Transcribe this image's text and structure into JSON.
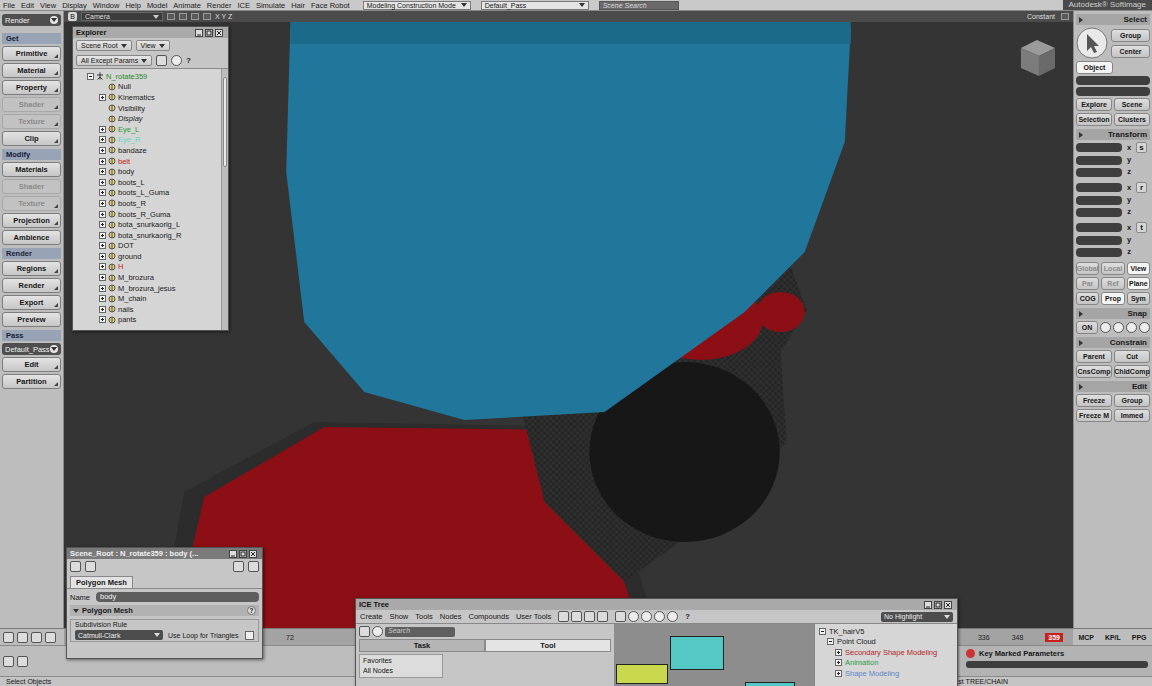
{
  "menu_bar": {
    "items": [
      "File",
      "Edit",
      "View",
      "Display",
      "Window",
      "Help",
      "Model",
      "Animate",
      "Render",
      "ICE",
      "Simulate",
      "Hair",
      "Face Robot"
    ],
    "mode": "Modeling Construction Mode",
    "pass": "Default_Pass",
    "search_placeholder": "Scene Search",
    "brand": "Autodesk® Softimage"
  },
  "left_toolbar": {
    "mode": "Render",
    "items": [
      {
        "label": "Get",
        "kind": "header",
        "disabled": false,
        "menu": false
      },
      {
        "label": "Primitive",
        "kind": "button",
        "disabled": false,
        "menu": true
      },
      {
        "label": "Material",
        "kind": "button",
        "disabled": false,
        "menu": true
      },
      {
        "label": "Property",
        "kind": "button",
        "disabled": false,
        "menu": true
      },
      {
        "label": "Shader",
        "kind": "button",
        "disabled": true,
        "menu": true
      },
      {
        "label": "Texture",
        "kind": "button",
        "disabled": true,
        "menu": true
      },
      {
        "label": "Clip",
        "kind": "button",
        "disabled": false,
        "menu": true
      },
      {
        "label": "Modify",
        "kind": "header",
        "disabled": false,
        "menu": false
      },
      {
        "label": "Materials",
        "kind": "button",
        "disabled": false,
        "menu": false
      },
      {
        "label": "Shader",
        "kind": "button",
        "disabled": true,
        "menu": false
      },
      {
        "label": "Texture",
        "kind": "button",
        "disabled": true,
        "menu": true
      },
      {
        "label": "Projection",
        "kind": "button",
        "disabled": false,
        "menu": true
      },
      {
        "label": "Ambience",
        "kind": "button",
        "disabled": false,
        "menu": false
      },
      {
        "label": "Render",
        "kind": "header",
        "disabled": false,
        "menu": false
      },
      {
        "label": "Regions",
        "kind": "button",
        "disabled": false,
        "menu": true
      },
      {
        "label": "Render",
        "kind": "button",
        "disabled": false,
        "menu": true
      },
      {
        "label": "Export",
        "kind": "button",
        "disabled": false,
        "menu": true
      },
      {
        "label": "Preview",
        "kind": "button",
        "disabled": false,
        "menu": false
      },
      {
        "label": "Pass",
        "kind": "header",
        "disabled": false,
        "menu": false
      },
      {
        "label": "Default_Pass",
        "kind": "dropdown",
        "disabled": false,
        "menu": false
      },
      {
        "label": "Edit",
        "kind": "button",
        "disabled": false,
        "menu": true
      },
      {
        "label": "Partition",
        "kind": "button",
        "disabled": false,
        "menu": true
      }
    ]
  },
  "viewport": {
    "toggle": "B",
    "camera": "Camera",
    "axes": "X Y Z",
    "shading": "Constant"
  },
  "explorer": {
    "title": "Explorer",
    "buttons": [
      "Scene Root",
      "View"
    ],
    "filter": "All Except Params",
    "help": "?",
    "tree": [
      {
        "label": "N_rotate359",
        "depth": 0,
        "has_children": true,
        "expanded": true,
        "italic": false,
        "color": "#2a8a2a"
      },
      {
        "label": "Null",
        "depth": 1,
        "has_children": false,
        "expanded": false,
        "italic": false,
        "color": "#1a1a1a"
      },
      {
        "label": "Kinematics",
        "depth": 1,
        "has_children": true,
        "expanded": false,
        "italic": false,
        "color": "#1a1a1a"
      },
      {
        "label": "Visibility",
        "depth": 1,
        "has_children": false,
        "expanded": false,
        "italic": false,
        "color": "#1a1a1a"
      },
      {
        "label": "Display",
        "depth": 1,
        "has_children": false,
        "expanded": false,
        "italic": true,
        "color": "#1a1a1a"
      },
      {
        "label": "Eye_L",
        "depth": 1,
        "has_children": true,
        "expanded": false,
        "italic": false,
        "color": "#1f9a3a"
      },
      {
        "label": "Eye_R",
        "depth": 1,
        "has_children": true,
        "expanded": false,
        "italic": false,
        "color": "#62d6c0"
      },
      {
        "label": "bandaze",
        "depth": 1,
        "has_children": true,
        "expanded": false,
        "italic": false,
        "color": "#1a1a1a"
      },
      {
        "label": "belt",
        "depth": 1,
        "has_children": true,
        "expanded": false,
        "italic": false,
        "color": "#c41818"
      },
      {
        "label": "body",
        "depth": 1,
        "has_children": true,
        "expanded": false,
        "italic": false,
        "color": "#1a1a1a"
      },
      {
        "label": "boots_L",
        "depth": 1,
        "has_children": true,
        "expanded": false,
        "italic": false,
        "color": "#1a1a1a"
      },
      {
        "label": "boots_L_Guma",
        "depth": 1,
        "has_children": true,
        "expanded": false,
        "italic": false,
        "color": "#1a1a1a"
      },
      {
        "label": "boots_R",
        "depth": 1,
        "has_children": true,
        "expanded": false,
        "italic": false,
        "color": "#1a1a1a"
      },
      {
        "label": "boots_R_Guma",
        "depth": 1,
        "has_children": true,
        "expanded": false,
        "italic": false,
        "color": "#1a1a1a"
      },
      {
        "label": "bota_snurkaorig_L",
        "depth": 1,
        "has_children": true,
        "expanded": false,
        "italic": false,
        "color": "#1a1a1a"
      },
      {
        "label": "bota_snurkaorig_R",
        "depth": 1,
        "has_children": true,
        "expanded": false,
        "italic": false,
        "color": "#1a1a1a"
      },
      {
        "label": "DOT",
        "depth": 1,
        "has_children": true,
        "expanded": false,
        "italic": false,
        "color": "#1a1a1a"
      },
      {
        "label": "ground",
        "depth": 1,
        "has_children": true,
        "expanded": false,
        "italic": false,
        "color": "#1a1a1a"
      },
      {
        "label": "H",
        "depth": 1,
        "has_children": true,
        "expanded": false,
        "italic": false,
        "color": "#c41818"
      },
      {
        "label": "M_brozura",
        "depth": 1,
        "has_children": true,
        "expanded": false,
        "italic": false,
        "color": "#1a1a1a"
      },
      {
        "label": "M_brozura_jesus",
        "depth": 1,
        "has_children": true,
        "expanded": false,
        "italic": false,
        "color": "#1a1a1a"
      },
      {
        "label": "M_chain",
        "depth": 1,
        "has_children": true,
        "expanded": false,
        "italic": false,
        "color": "#1a1a1a"
      },
      {
        "label": "nails",
        "depth": 1,
        "has_children": true,
        "expanded": false,
        "italic": false,
        "color": "#1a1a1a"
      },
      {
        "label": "pants",
        "depth": 1,
        "has_children": true,
        "expanded": false,
        "italic": false,
        "color": "#1a1a1a"
      }
    ]
  },
  "property_panel": {
    "title": "Scene_Root : N_rotate359 : body (...",
    "tab": "Polygon Mesh",
    "name_label": "Name",
    "name_value": "body",
    "section": "Polygon Mesh",
    "help": "?",
    "group": "Subdivision Rule",
    "rule": "Catmull-Clark",
    "checkbox": {
      "label": "Use Loop for Triangles",
      "checked": false
    }
  },
  "ice_tree": {
    "title": "ICE Tree",
    "menus": [
      "Create",
      "Show",
      "Tools",
      "Nodes",
      "Compounds",
      "User Tools"
    ],
    "help": "?",
    "highlight": "No Highlight",
    "search_placeholder": "Search",
    "tabs": [
      {
        "label": "Task",
        "selected": false
      },
      {
        "label": "Tool",
        "selected": true
      }
    ],
    "library": [
      "Favorites",
      "All Nodes"
    ],
    "nodes": [
      {
        "color": "#c9d84c"
      },
      {
        "color": "#55c8c6"
      },
      {
        "color": "#55c8c6"
      }
    ],
    "explorer": [
      {
        "label": "TK_hairV5",
        "depth": 0,
        "color": "#1a1a1a"
      },
      {
        "label": "Point Cloud",
        "depth": 1,
        "color": "#1a1a1a"
      },
      {
        "label": "Secondary Shape Modeling",
        "depth": 2,
        "color": "#b3262b"
      },
      {
        "label": "Animation",
        "depth": 2,
        "color": "#2f9a45"
      },
      {
        "label": "Shape Modeling",
        "depth": 2,
        "color": "#5b86c6"
      }
    ]
  },
  "right_panel": {
    "select": {
      "header": "Select",
      "buttons": [
        "Group",
        "Center"
      ],
      "filter": {
        "label": "Object",
        "selected": true
      }
    },
    "explore_buttons": [
      "Explore",
      "Scene",
      "Selection",
      "Clusters"
    ],
    "transform": {
      "header": "Transform",
      "groups": [
        {
          "tool": "s",
          "axes": [
            "x",
            "y",
            "z"
          ]
        },
        {
          "tool": "r",
          "axes": [
            "x",
            "y",
            "z"
          ]
        },
        {
          "tool": "t",
          "axes": [
            "x",
            "y",
            "z"
          ]
        }
      ],
      "toggles": [
        [
          {
            "label": "Global",
            "selected": false,
            "disabled": true
          },
          {
            "label": "Local",
            "selected": false,
            "disabled": true
          },
          {
            "label": "View",
            "selected": true,
            "disabled": false
          }
        ],
        [
          {
            "label": "Par",
            "selected": false,
            "disabled": true
          },
          {
            "label": "Ref",
            "selected": false,
            "disabled": true
          },
          {
            "label": "Plane",
            "selected": true,
            "disabled": false
          }
        ],
        [
          {
            "label": "COG",
            "selected": false,
            "disabled": false
          },
          {
            "label": "Prop",
            "selected": true,
            "disabled": false
          },
          {
            "label": "Sym",
            "selected": false,
            "disabled": false
          }
        ]
      ]
    },
    "snap": {
      "header": "Snap",
      "toggle": "ON"
    },
    "constrain": {
      "header": "Constrain",
      "buttons": [
        "Parent",
        "Cut",
        "CnsComp",
        "ChldComp"
      ]
    },
    "edit": {
      "header": "Edit",
      "buttons": [
        "Freeze",
        "Group",
        "Freeze M",
        "Immed"
      ]
    }
  },
  "timeline": {
    "start": "72",
    "ticks": [
      "336",
      "348"
    ],
    "current": "359",
    "modes": [
      "MCP",
      "KP/L",
      "PPG"
    ],
    "keys_label": "Key Marked Parameters"
  },
  "status_bar": {
    "message": "Select Objects",
    "context": "st TREE/CHAIN"
  }
}
